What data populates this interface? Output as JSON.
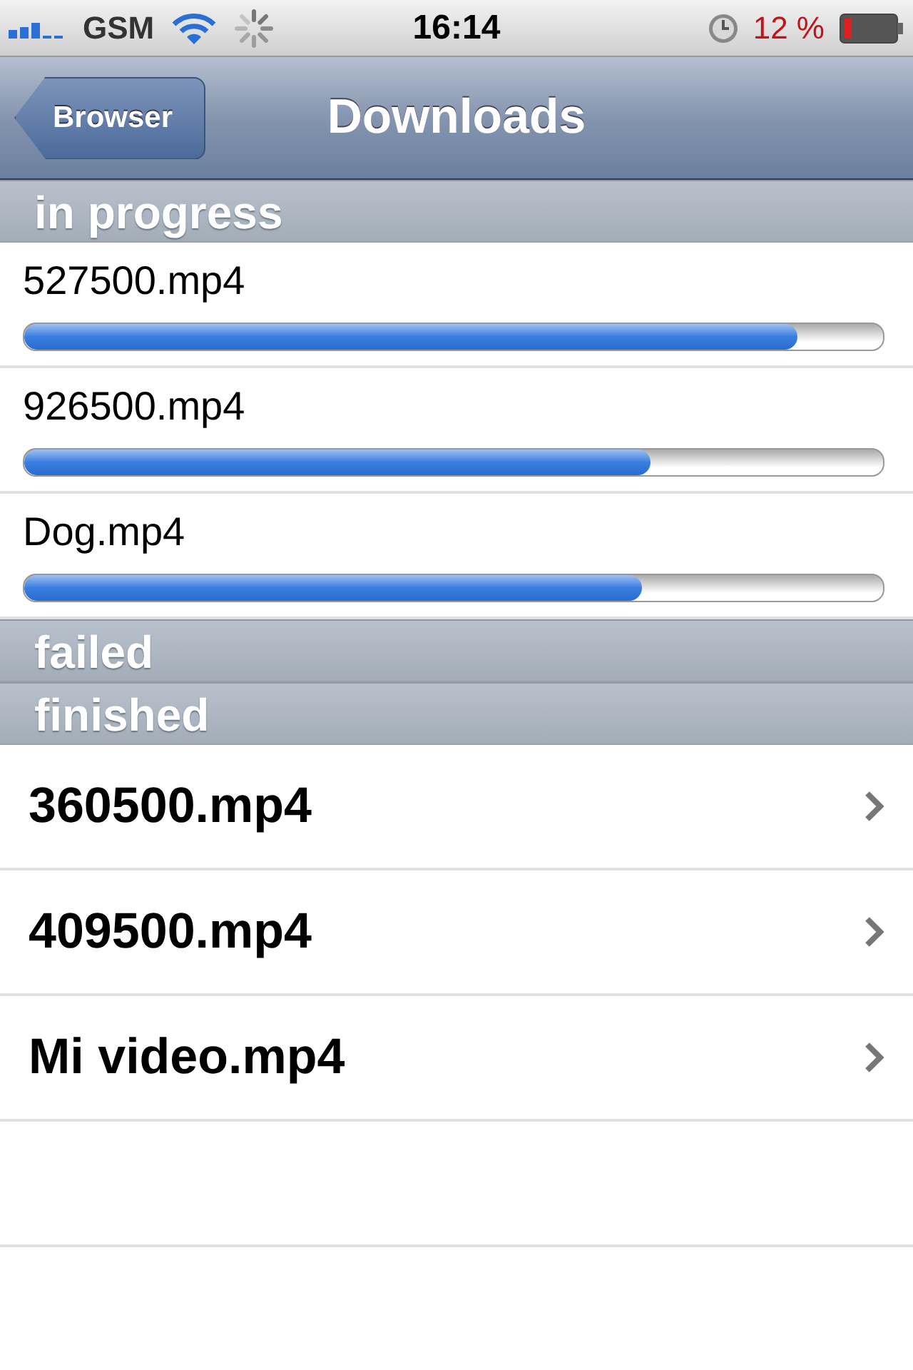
{
  "status_bar": {
    "carrier": "GSM",
    "time": "16:14",
    "battery": "12 %"
  },
  "nav_bar": {
    "back_button": "Browser",
    "title": "Downloads"
  },
  "sections": [
    {
      "title": "in progress",
      "kind": "progress",
      "items": [
        {
          "name": "527500.mp4",
          "level": 0.9
        },
        {
          "name": "926500.mp4",
          "level": 0.73
        },
        {
          "name": "Dog.mp4",
          "level": 0.72
        }
      ]
    },
    {
      "title": "failed"
    },
    {
      "title": "finished",
      "kind": "finished",
      "items": [
        {
          "name": "360500.mp4"
        },
        {
          "name": "409500.mp4"
        },
        {
          "name": "Mi video.mp4"
        }
      ]
    }
  ]
}
